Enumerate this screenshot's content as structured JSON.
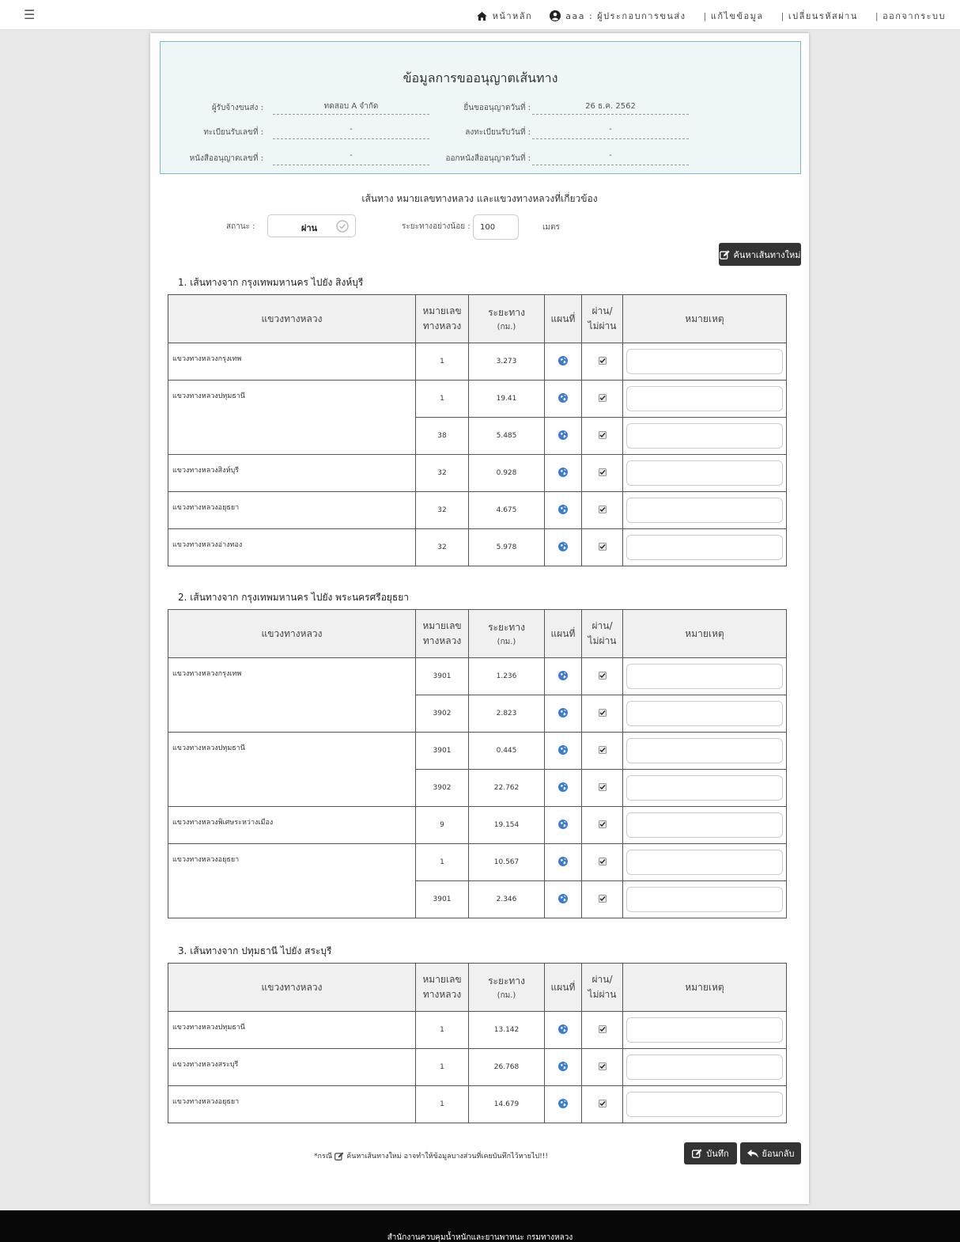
{
  "nav": {
    "menu_icon": "hamburger-icon",
    "home": "หน้าหลัก",
    "user": "aaa : ผู้ประกอบการขนส่ง",
    "edit_profile": "แก้ไขข้อมูล",
    "change_password": "เปลี่ยนรหัสผ่าน",
    "logout": "ออกจากระบบ",
    "separator": "|"
  },
  "info": {
    "title": "ข้อมูลการขออนุญาตเส้นทาง",
    "carrier_label": "ผู้รับจ้างขนส่ง :",
    "carrier_value": "ทดสอบ A จำกัด",
    "request_date_label": "ยื่นขออนุญาตวันที่ :",
    "request_date_value": "26 ธ.ค. 2562",
    "reg_no_label": "ทะเบียนรับเลขที่ :",
    "reg_no_value": "-",
    "reg_date_label": "ลงทะเบียนรับวันที่ :",
    "reg_date_value": "-",
    "permit_no_label": "หนังสืออนุญาตเลขที่ :",
    "permit_no_value": "-",
    "permit_date_label": "ออกหนังสืออนุญาตวันที่ :",
    "permit_date_value": "-"
  },
  "filter": {
    "heading": "เส้นทาง หมายเลขทางหลวง และแขวงทางหลวงที่เกี่ยวข้อง",
    "status_label": "สถานะ :",
    "status_value": "ผ่าน",
    "distance_label": "ระยะทางอย่างน้อย :",
    "distance_value": "100",
    "distance_unit": "เมตร",
    "search_button": "ค้นหาเส้นทางใหม่"
  },
  "table_headers": {
    "district": "แขวงทางหลวง",
    "highway_no_1": "หมายเลข",
    "highway_no_2": "ทางหลวง",
    "distance_1": "ระยะทาง",
    "distance_2": "(กม.)",
    "map": "แผนที่",
    "pass_1": "ผ่าน/",
    "pass_2": "ไม่ผ่าน",
    "note": "หมายเหตุ"
  },
  "routes": [
    {
      "title": "1. เส้นทางจาก กรุงเทพมหานคร ไปยัง สิงห์บุรี",
      "rows": [
        {
          "district": "แขวงทางหลวงกรุงเทพ",
          "highway": "1",
          "distance": "3.273",
          "passed": true
        },
        {
          "district": "แขวงทางหลวงปทุมธานี",
          "highway": "1",
          "distance": "19.41",
          "passed": true
        },
        {
          "district": "",
          "highway": "38",
          "distance": "5.485",
          "passed": true
        },
        {
          "district": "แขวงทางหลวงสิงห์บุรี",
          "highway": "32",
          "distance": "0.928",
          "passed": true
        },
        {
          "district": "แขวงทางหลวงอยุธยา",
          "highway": "32",
          "distance": "4.675",
          "passed": true
        },
        {
          "district": "แขวงทางหลวงอ่างทอง",
          "highway": "32",
          "distance": "5.978",
          "passed": true
        }
      ]
    },
    {
      "title": "2. เส้นทางจาก กรุงเทพมหานคร ไปยัง พระนครศรีอยุธยา",
      "rows": [
        {
          "district": "แขวงทางหลวงกรุงเทพ",
          "highway": "3901",
          "distance": "1.236",
          "passed": true
        },
        {
          "district": "",
          "highway": "3902",
          "distance": "2.823",
          "passed": true
        },
        {
          "district": "แขวงทางหลวงปทุมธานี",
          "highway": "3901",
          "distance": "0.445",
          "passed": true
        },
        {
          "district": "",
          "highway": "3902",
          "distance": "22.762",
          "passed": true
        },
        {
          "district": "แขวงทางหลวงพิเศษระหว่างเมือง",
          "highway": "9",
          "distance": "19.154",
          "passed": true
        },
        {
          "district": "แขวงทางหลวงอยุธยา",
          "highway": "1",
          "distance": "10.567",
          "passed": true
        },
        {
          "district": "",
          "highway": "3901",
          "distance": "2.346",
          "passed": true
        }
      ]
    },
    {
      "title": "3. เส้นทางจาก ปทุมธานี ไปยัง สระบุรี",
      "rows": [
        {
          "district": "แขวงทางหลวงปทุมธานี",
          "highway": "1",
          "distance": "13.142",
          "passed": true
        },
        {
          "district": "แขวงทางหลวงสระบุรี",
          "highway": "1",
          "distance": "26.768",
          "passed": true
        },
        {
          "district": "แขวงทางหลวงอยุธยา",
          "highway": "1",
          "distance": "14.679",
          "passed": true
        }
      ]
    }
  ],
  "bottom": {
    "footnote_pre": "*กรณี",
    "footnote_post": "ค้นหาเส้นทางใหม่ อาจทำให้ข้อมูลบางส่วนที่เคยบันทึกไว้หายไป!!!",
    "save_button": "บันทึก",
    "back_button": "ย้อนกลับ"
  },
  "footer": {
    "text": "สำนักงานควบคุมน้ำหนักและยานพาหนะ กรมทางหลวง"
  },
  "colors": {
    "info_bg": "#eef6f8",
    "info_border": "#7fb6c8",
    "button_dark": "#333333",
    "globe_blue": "#3a7bd5",
    "footer_bg": "#080808"
  }
}
